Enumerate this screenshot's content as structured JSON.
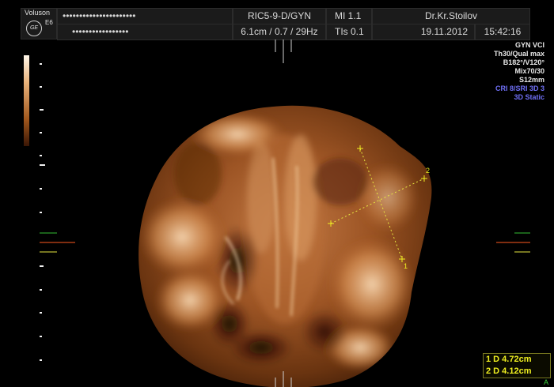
{
  "header": {
    "brand": "Voluson",
    "probe": "E6",
    "ge_logo_text": "GE",
    "patient_name_mask": "••••••••••••••••••••••",
    "patient_id_mask": "•••••••••••••••••",
    "probe_preset": "RIC5-9-D/GYN",
    "depth_info": "6.1cm / 0.7 / 29Hz",
    "mi": "MI  1.1",
    "tis": "TIs  0.1",
    "operator": "Dr.Kr.Stoilov",
    "date": "19.11.2012",
    "time": "15:42:16"
  },
  "params": {
    "preset": "GYN VCI",
    "thickness": "Th30/Qual max",
    "angles": "B182°/V120°",
    "mix": "Mix70/30",
    "slice": "S12mm",
    "cri": "CRI 8/SRI 3D 3",
    "mode": "3D Static"
  },
  "calipers": {
    "c1": "1",
    "c2": "2"
  },
  "measurements": [
    {
      "label": "1  D 4.72cm"
    },
    {
      "label": "2  D 4.12cm"
    }
  ],
  "footer": {
    "u_button": "A"
  },
  "colors": {
    "accent": "#f0f020",
    "render_hot": "#f3c99a",
    "render_dark": "#3b1a07",
    "blue_text": "#6f6ff5"
  }
}
